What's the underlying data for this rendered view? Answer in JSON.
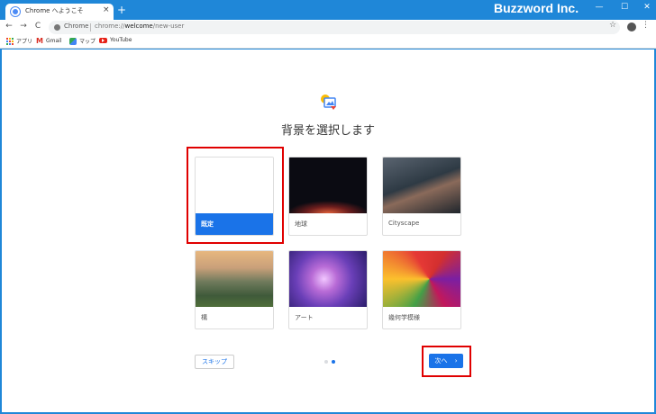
{
  "browser": {
    "tab_title": "Chrome へようこそ",
    "tab_close": "×",
    "new_tab": "+",
    "brand": "Buzzword Inc.",
    "window_controls": {
      "minimize": "—",
      "maximize": "☐",
      "close": "✕"
    },
    "nav": {
      "back": "←",
      "forward": "→",
      "reload": "C"
    },
    "omnibox": {
      "chip": "Chrome",
      "url_prefix": "chrome://",
      "url_host": "welcome",
      "url_path": "/new-user"
    },
    "star": "☆",
    "menu": "⋮"
  },
  "bookmarks": [
    {
      "label": "アプリ",
      "icon": "apps-icon"
    },
    {
      "label": "Gmail",
      "icon": "gmail-icon"
    },
    {
      "label": "マップ",
      "icon": "maps-icon"
    },
    {
      "label": "YouTube",
      "icon": "youtube-icon"
    }
  ],
  "page": {
    "title": "背景を選択します",
    "backgrounds": [
      {
        "label": "既定",
        "selected": true
      },
      {
        "label": "地球",
        "selected": false
      },
      {
        "label": "Cityscape",
        "selected": false
      },
      {
        "label": "構",
        "selected": false
      },
      {
        "label": "アート",
        "selected": false
      },
      {
        "label": "幾何学模様",
        "selected": false
      }
    ],
    "skip_label": "スキップ",
    "next_label": "次へ",
    "next_arrow": "›",
    "pager": {
      "total": 2,
      "current": 2
    }
  },
  "colors": {
    "accent": "#1a73e8",
    "title_bar": "#1f87d8",
    "highlight": "#e00000"
  }
}
